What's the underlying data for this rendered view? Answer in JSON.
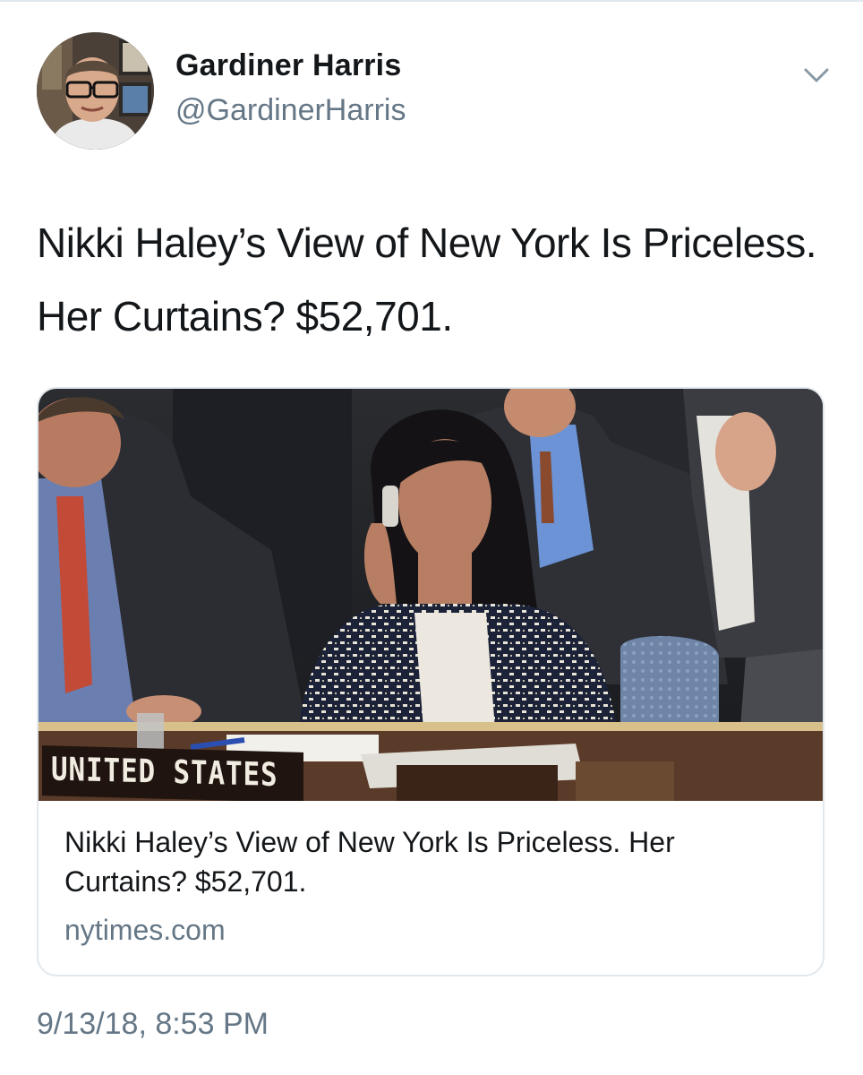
{
  "author": {
    "display_name": "Gardiner Harris",
    "handle": "@GardinerHarris"
  },
  "tweet": {
    "text": "Nikki Haley’s View of New York Is Priceless. Her Curtains? $52,701.",
    "timestamp": "9/13/18, 8:53 PM"
  },
  "card": {
    "image_placard": "UNITED STATES",
    "title": "Nikki Haley’s View of New York Is Priceless. Her Curtains? $52,701.",
    "domain": "nytimes.com"
  },
  "icons": {
    "menu": "chevron-down-icon",
    "avatar": "avatar"
  },
  "colors": {
    "primary_text": "#14171a",
    "secondary_text": "#657786",
    "border": "#e1e8ed"
  }
}
